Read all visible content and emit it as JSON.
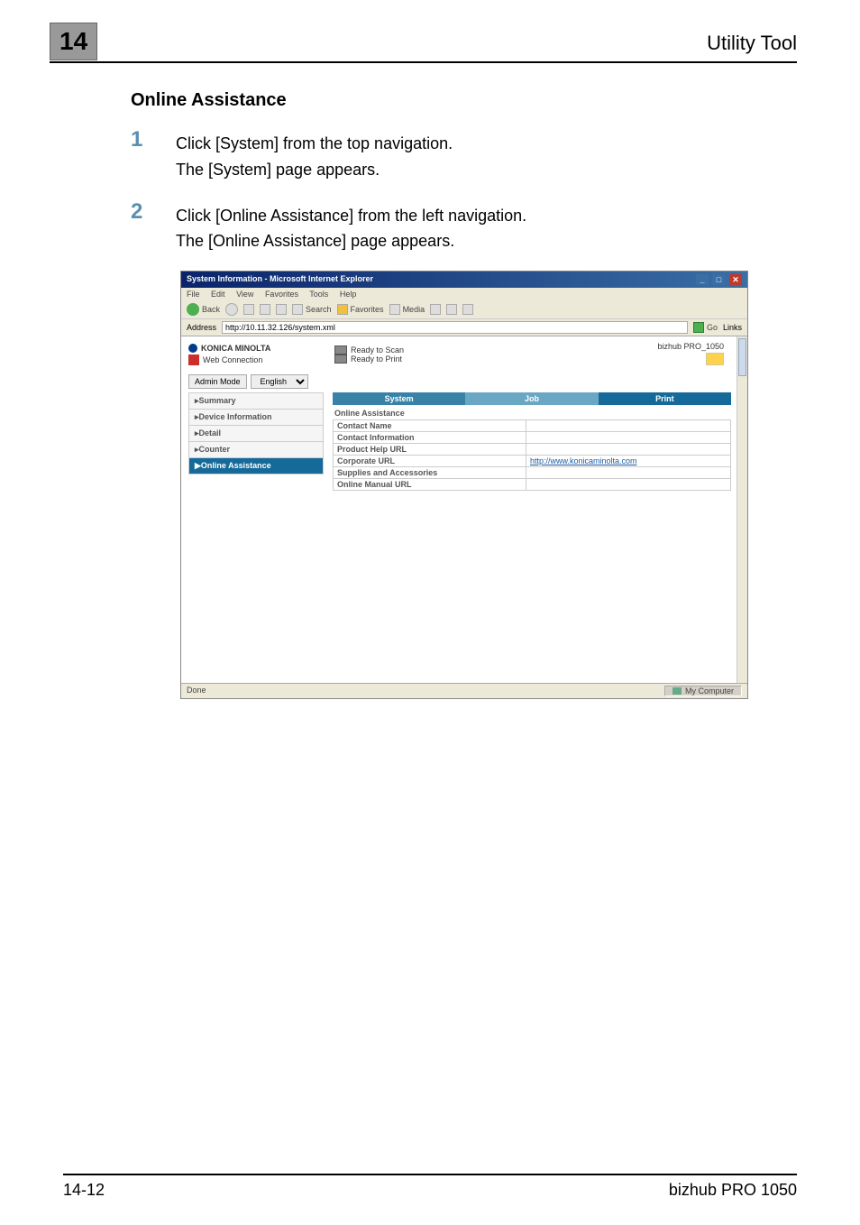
{
  "chapter_number": "14",
  "header_title": "Utility Tool",
  "subheading": "Online Assistance",
  "steps": [
    {
      "num": "1",
      "line1": "Click [System] from the top navigation.",
      "line2": "The [System] page appears."
    },
    {
      "num": "2",
      "line1": "Click [Online Assistance] from the left navigation.",
      "line2": "The [Online Assistance] page appears."
    }
  ],
  "ie": {
    "title": "System Information - Microsoft Internet Explorer",
    "menus": [
      "File",
      "Edit",
      "View",
      "Favorites",
      "Tools",
      "Help"
    ],
    "toolbar_back": "Back",
    "toolbar_search": "Search",
    "toolbar_favorites": "Favorites",
    "toolbar_media": "Media",
    "address_label": "Address",
    "address_value": "http://10.11.32.126/system.xml",
    "go_label": "Go",
    "links_label": "Links",
    "status_done": "Done",
    "status_zone": "My Computer"
  },
  "page": {
    "brand": "KONICA MINOLTA",
    "webconn": "Web Connection",
    "status_scan": "Ready to Scan",
    "status_print": "Ready to Print",
    "model": "bizhub PRO_1050",
    "admin_mode": "Admin Mode",
    "lang": "English",
    "tabs": {
      "system": "System",
      "job": "Job",
      "print": "Print"
    },
    "nav": {
      "summary": "▸Summary",
      "device": "▸Device Information",
      "detail": "▸Detail",
      "counter": "▸Counter",
      "online": "▶Online Assistance"
    },
    "oa": {
      "heading": "Online Assistance",
      "rows": [
        {
          "label": "Contact Name",
          "value": ""
        },
        {
          "label": "Contact Information",
          "value": ""
        },
        {
          "label": "Product Help URL",
          "value": ""
        },
        {
          "label": "Corporate URL",
          "value": "http://www.konicaminolta.com"
        },
        {
          "label": "Supplies and Accessories",
          "value": ""
        },
        {
          "label": "Online Manual URL",
          "value": ""
        }
      ]
    }
  },
  "footer": {
    "left": "14-12",
    "right": "bizhub PRO 1050"
  }
}
